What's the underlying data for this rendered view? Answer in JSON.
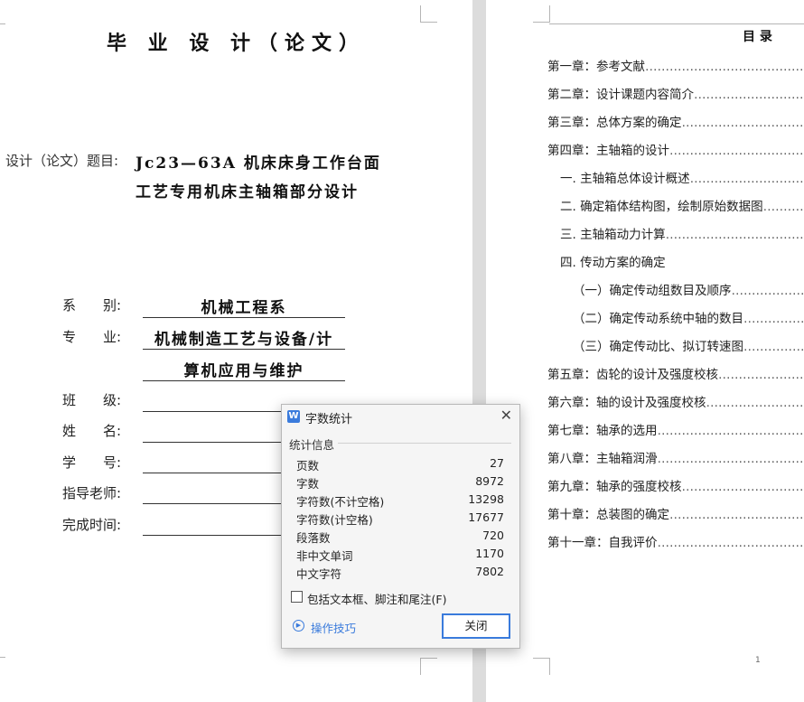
{
  "left_page": {
    "title": "毕 业 设 计（论文）",
    "topic_label": "设计（论文）题目:",
    "topic_line1": "Jc23—63A 机床床身工作台面",
    "topic_line2": "工艺专用机床主轴箱部分设计",
    "fields": {
      "dept_label": "系　　别:",
      "dept_value": "机械工程系",
      "major_label": "专　　业:",
      "major_value1": "机械制造工艺与设备/计",
      "major_value2": "算机应用与维护",
      "class_label": "班　　级:",
      "name_label": "姓　　名:",
      "id_label": "学　　号:",
      "advisor_label": "指导老师:",
      "date_label": "完成时间:"
    }
  },
  "right_page": {
    "toc_title": "目 录",
    "items": [
      "第一章：参考文献",
      "第二章：设计课题内容简介",
      "第三章：总体方案的确定",
      "第四章：主轴箱的设计",
      "一. 主轴箱总体设计概述",
      "二. 确定箱体结构图，绘制原始数据图",
      "三. 主轴箱动力计算",
      "四. 传动方案的确定",
      "（一）确定传动组数目及顺序",
      "（二）确定传动系统中轴的数目",
      "（三）确定传动比、拟订转速图",
      "第五章：齿轮的设计及强度校核",
      "第六章：轴的设计及强度校核",
      "第七章：轴承的选用",
      "第八章：主轴箱润滑",
      "第九章：轴承的强度校核",
      "第十章：总装图的确定",
      "第十一章：自我评价"
    ],
    "page_number": "1"
  },
  "dialog": {
    "app_icon": "W",
    "title": "字数统计",
    "section_label": "统计信息",
    "stats": [
      {
        "label": "页数",
        "value": "27"
      },
      {
        "label": "字数",
        "value": "8972"
      },
      {
        "label": "字符数(不计空格)",
        "value": "13298"
      },
      {
        "label": "字符数(计空格)",
        "value": "17677"
      },
      {
        "label": "段落数",
        "value": "720"
      },
      {
        "label": "非中文单词",
        "value": "1170"
      },
      {
        "label": "中文字符",
        "value": "7802"
      }
    ],
    "checkbox_label": "包括文本框、脚注和尾注(F)",
    "tips_label": "操作技巧",
    "close_label": "关闭"
  }
}
